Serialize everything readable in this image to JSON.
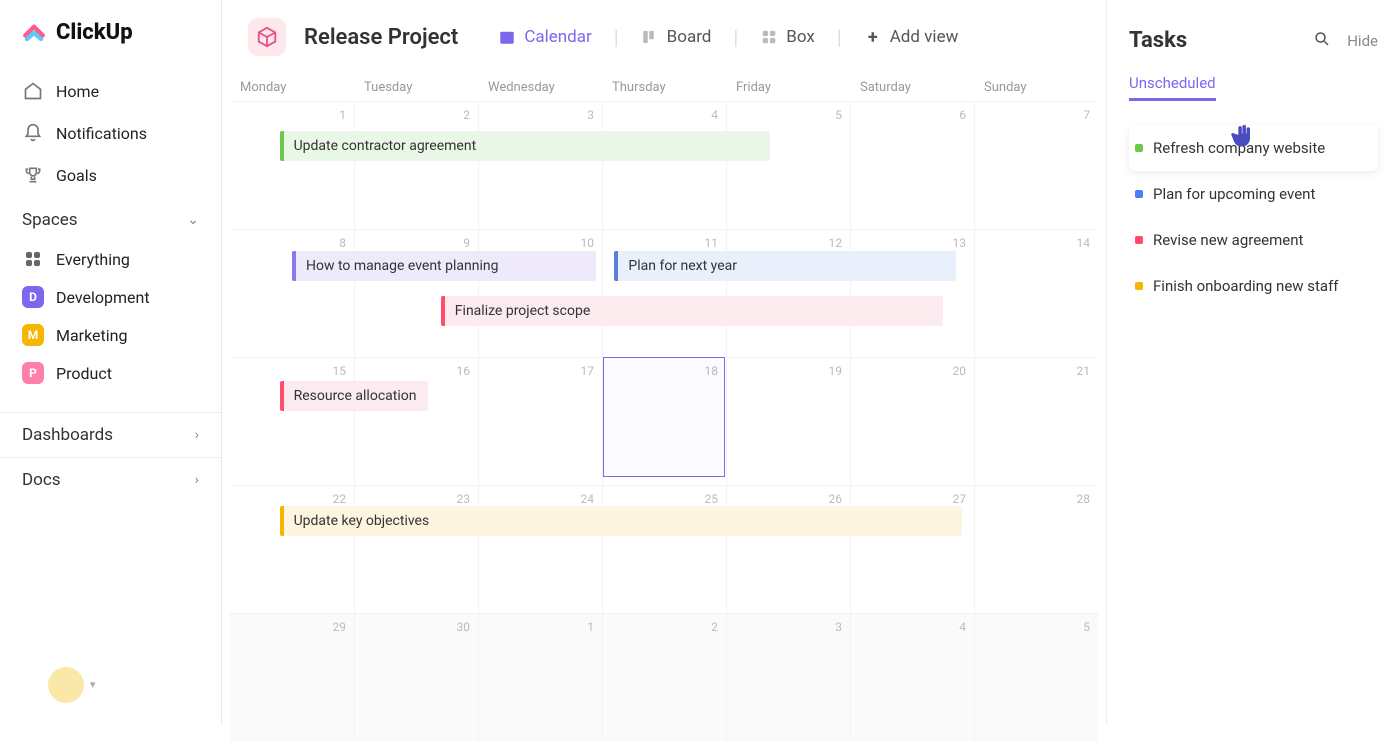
{
  "logo": "ClickUp",
  "nav": {
    "home": "Home",
    "notifications": "Notifications",
    "goals": "Goals"
  },
  "spaces": {
    "header": "Spaces",
    "everything": "Everything",
    "items": [
      {
        "label": "Development",
        "letter": "D",
        "color": "#7b68ee"
      },
      {
        "label": "Marketing",
        "letter": "M",
        "color": "#f7b500"
      },
      {
        "label": "Product",
        "letter": "P",
        "color": "#ff7fab"
      }
    ]
  },
  "collapsibles": {
    "dashboards": "Dashboards",
    "docs": "Docs"
  },
  "project": {
    "title": "Release Project"
  },
  "views": {
    "calendar": "Calendar",
    "board": "Board",
    "box": "Box",
    "add": "Add view"
  },
  "weekdays": [
    "Monday",
    "Tuesday",
    "Wednesday",
    "Thursday",
    "Friday",
    "Saturday",
    "Sunday"
  ],
  "dates": {
    "w1": [
      "",
      "1",
      "2",
      "3",
      "4",
      "5",
      "6",
      "7"
    ],
    "w2": [
      "8",
      "9",
      "10",
      "11",
      "12",
      "13",
      "14"
    ],
    "w3": [
      "15",
      "16",
      "17",
      "18",
      "19",
      "20",
      "21"
    ],
    "w4": [
      "22",
      "23",
      "24",
      "25",
      "26",
      "27",
      "28"
    ],
    "w5": [
      "29",
      "30",
      "1",
      "2",
      "3",
      "4",
      "5"
    ]
  },
  "events": {
    "e1": {
      "label": "Update contractor agreement"
    },
    "e2": {
      "label": "How to manage event planning"
    },
    "e3": {
      "label": "Plan for next year"
    },
    "e4": {
      "label": "Finalize project scope"
    },
    "e5": {
      "label": "Resource allocation"
    },
    "e6": {
      "label": "Update key objectives"
    }
  },
  "tasks": {
    "title": "Tasks",
    "hide": "Hide",
    "tab": "Unscheduled",
    "items": [
      {
        "label": "Refresh company website",
        "color": "#6bc950"
      },
      {
        "label": "Plan for upcoming event",
        "color": "#4a7ff7"
      },
      {
        "label": "Revise new agreement",
        "color": "#ff4d6d"
      },
      {
        "label": "Finish onboarding new staff",
        "color": "#f7b500"
      }
    ]
  },
  "colors": {
    "green_bg": "#e9f7e6",
    "green_border": "#6bc950",
    "purple_bg": "#eeeafc",
    "purple_border": "#8b79ee",
    "blue_bg": "#eaf0fb",
    "blue_border": "#5b7fd9",
    "pink_bg": "#fbeaee",
    "pink_border": "#ff4d6d",
    "yellow_bg": "#fdf5e0",
    "yellow_border": "#f7b500"
  }
}
